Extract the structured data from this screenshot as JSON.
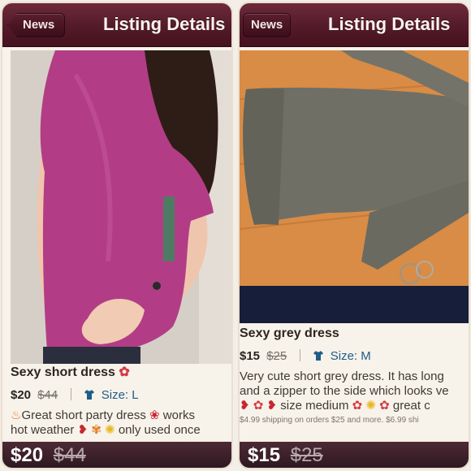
{
  "left": {
    "nav": {
      "back_label": "News",
      "title": "Listing Details"
    },
    "item": {
      "title": "Sexy short dress",
      "price": "$20",
      "original_price": "$44",
      "size_label": "Size: L",
      "description_line1": "Great short party dress",
      "description_line1_tail": "works",
      "description_line2": "hot weather",
      "description_line2_tail": "only used once"
    },
    "bottom": {
      "price": "$20",
      "original_price": "$44"
    }
  },
  "right": {
    "nav": {
      "back_label": "News",
      "title": "Listing Details"
    },
    "item": {
      "title": "Sexy grey dress",
      "price": "$15",
      "original_price": "$25",
      "size_label": "Size: M",
      "description_line1": "Very cute short grey dress. It has long",
      "description_line2": "and a zipper to the side which looks ve",
      "description_line3_mid": "size medium",
      "description_line3_tail": "great c",
      "shipping_note": "$4.99 shipping on orders $25 and more. $6.99 shi"
    },
    "bottom": {
      "price": "$15",
      "original_price": "$25"
    }
  },
  "colors": {
    "navbar": "#531a2a",
    "size_link": "#1f5c88",
    "dress_pink": "#b23d86",
    "dress_grey": "#6f6f66"
  }
}
